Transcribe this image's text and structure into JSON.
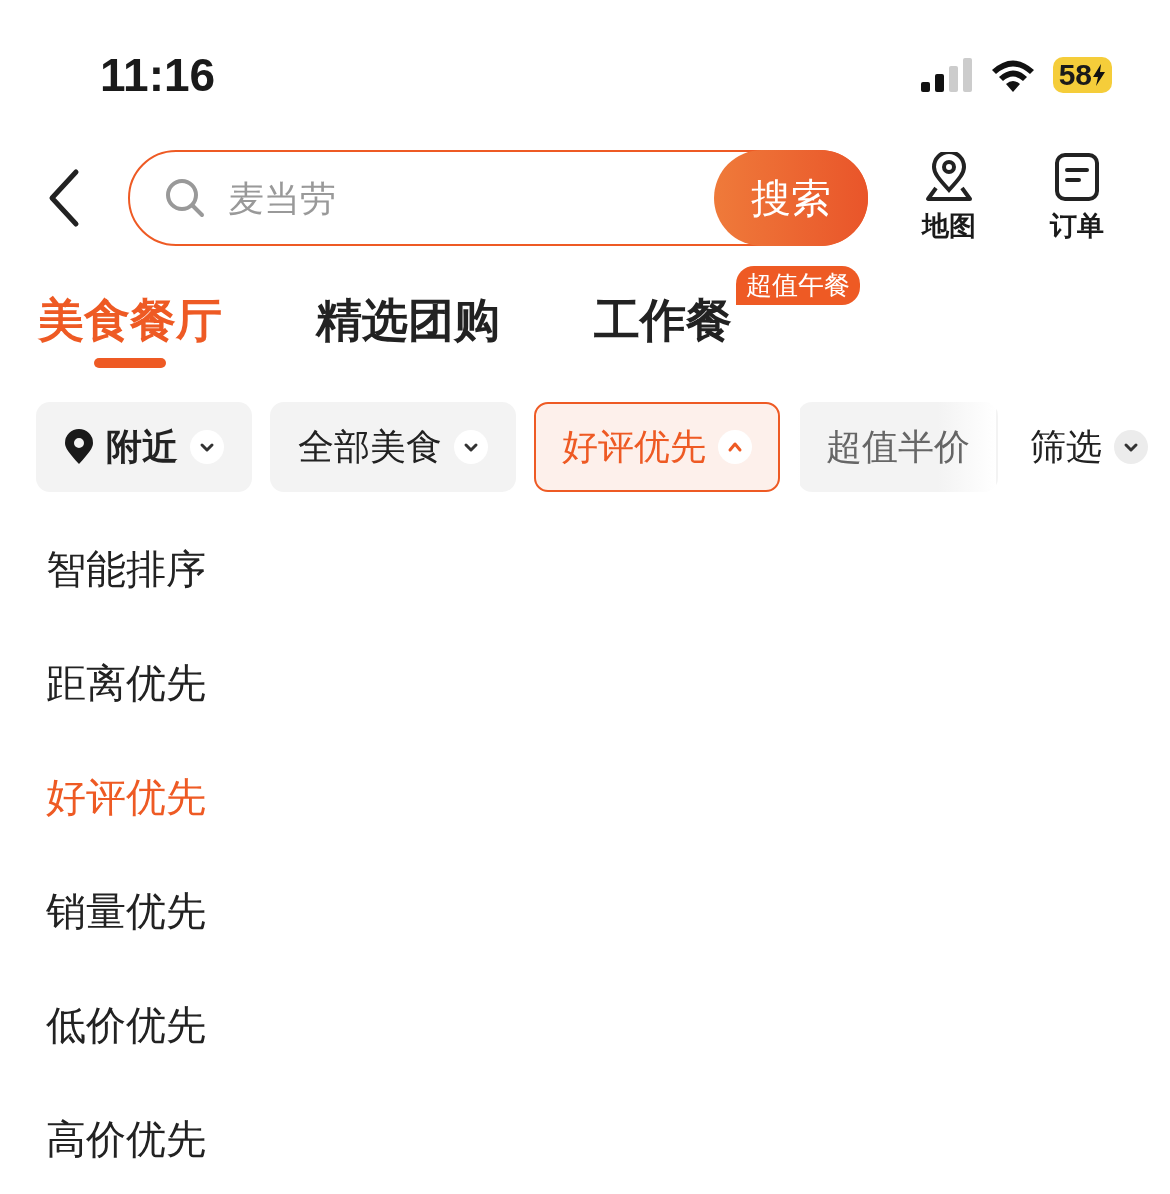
{
  "status_bar": {
    "time": "11:16",
    "battery": "58"
  },
  "search": {
    "placeholder": "麦当劳",
    "button": "搜索"
  },
  "header_actions": [
    {
      "kind": "map",
      "label": "地图"
    },
    {
      "kind": "order",
      "label": "订单"
    }
  ],
  "tabs": [
    {
      "label": "美食餐厅",
      "selected": true
    },
    {
      "label": "精选团购",
      "selected": false
    },
    {
      "label": "工作餐",
      "selected": false,
      "badge": "超值午餐"
    }
  ],
  "filters": [
    {
      "kind": "location",
      "label": "附近",
      "selected": false
    },
    {
      "kind": "dropdown",
      "label": "全部美食",
      "selected": false
    },
    {
      "kind": "dropdown",
      "label": "好评优先",
      "selected": true
    },
    {
      "kind": "toggle",
      "label": "超值半价",
      "selected": false
    },
    {
      "kind": "filter",
      "label": "筛选",
      "selected": false
    }
  ],
  "sort_options": [
    {
      "label": "智能排序",
      "selected": false
    },
    {
      "label": "距离优先",
      "selected": false
    },
    {
      "label": "好评优先",
      "selected": true
    },
    {
      "label": "销量优先",
      "selected": false
    },
    {
      "label": "低价优先",
      "selected": false
    },
    {
      "label": "高价优先",
      "selected": false
    }
  ]
}
